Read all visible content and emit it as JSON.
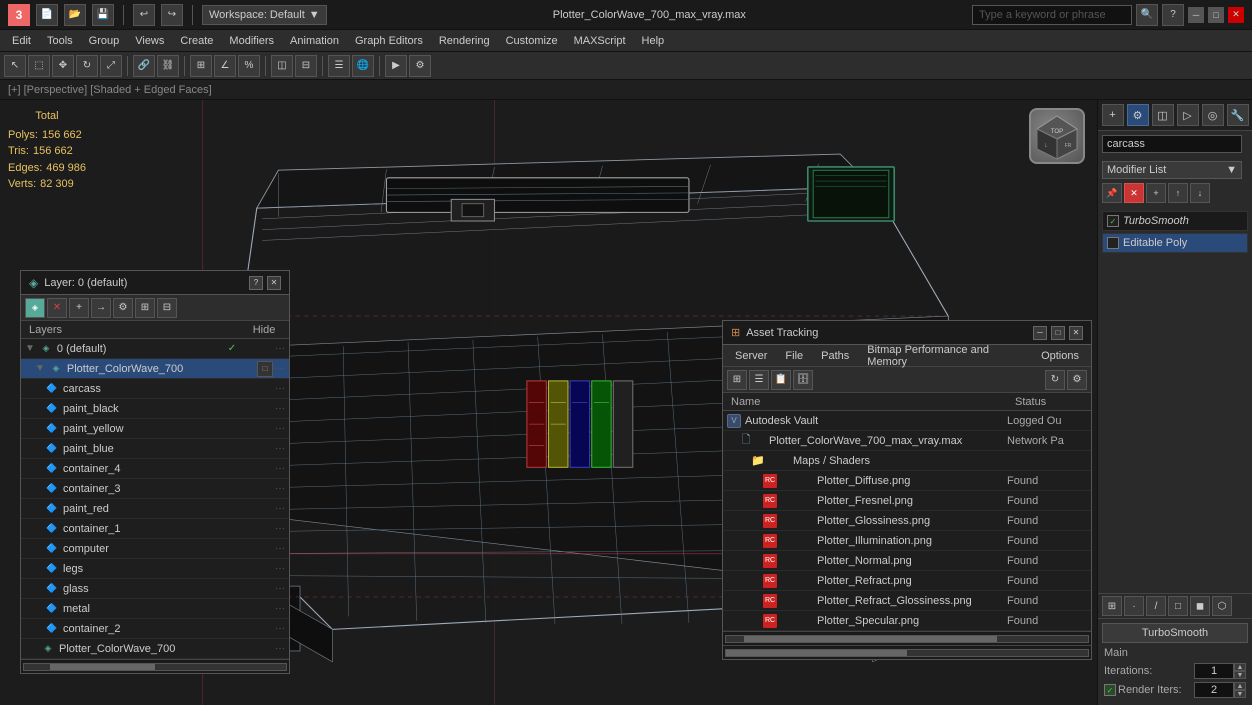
{
  "titlebar": {
    "filename": "Plotter_ColorWave_700_max_vray.max",
    "workspace_label": "Workspace: Default",
    "search_placeholder": "Type a keyword or phrase"
  },
  "menubar": {
    "items": [
      "Edit",
      "Tools",
      "Group",
      "Views",
      "Create",
      "Modifiers",
      "Animation",
      "Graph Editors",
      "Rendering",
      "Customize",
      "MAXScript",
      "Help"
    ]
  },
  "view_label": "[+] [Perspective] [Shaded + Edged Faces]",
  "stats": {
    "title": "Total",
    "polys_label": "Polys:",
    "polys_value": "156 662",
    "tris_label": "Tris:",
    "tris_value": "156 662",
    "edges_label": "Edges:",
    "edges_value": "469 986",
    "verts_label": "Verts:",
    "verts_value": "82 309"
  },
  "right_panel": {
    "name_field": "carcass",
    "modifier_list_label": "Modifier List",
    "modifiers": [
      {
        "name": "TurboSmooth",
        "checked": true,
        "italic": true
      },
      {
        "name": "Editable Poly",
        "checked": false,
        "italic": false
      }
    ],
    "turbosmooth": {
      "title": "TurboSmooth",
      "main_label": "Main",
      "iterations_label": "Iterations:",
      "iterations_value": "1",
      "render_iters_label": "Render Iters:",
      "render_iters_value": "2"
    }
  },
  "layer_panel": {
    "title": "Layer: 0 (default)",
    "question_mark": "?",
    "columns": {
      "name": "Layers",
      "hide": "Hide"
    },
    "items": [
      {
        "id": "layer-default",
        "name": "0 (default)",
        "indent": 0,
        "type": "layer",
        "checked": true,
        "active": false
      },
      {
        "id": "plotter-colorwave",
        "name": "Plotter_ColorWave_700",
        "indent": 1,
        "type": "object",
        "checked": false,
        "active": true
      },
      {
        "id": "carcass",
        "name": "carcass",
        "indent": 2,
        "type": "sub",
        "checked": false,
        "active": false
      },
      {
        "id": "paint-black",
        "name": "paint_black",
        "indent": 2,
        "type": "sub",
        "checked": false,
        "active": false
      },
      {
        "id": "paint-yellow",
        "name": "paint_yellow",
        "indent": 2,
        "type": "sub",
        "checked": false,
        "active": false
      },
      {
        "id": "paint-blue",
        "name": "paint_blue",
        "indent": 2,
        "type": "sub",
        "checked": false,
        "active": false
      },
      {
        "id": "container-4",
        "name": "container_4",
        "indent": 2,
        "type": "sub",
        "checked": false,
        "active": false
      },
      {
        "id": "container-3",
        "name": "container_3",
        "indent": 2,
        "type": "sub",
        "checked": false,
        "active": false
      },
      {
        "id": "paint-red",
        "name": "paint_red",
        "indent": 2,
        "type": "sub",
        "checked": false,
        "active": false
      },
      {
        "id": "container-1",
        "name": "container_1",
        "indent": 2,
        "type": "sub",
        "checked": false,
        "active": false
      },
      {
        "id": "computer",
        "name": "computer",
        "indent": 2,
        "type": "sub",
        "checked": false,
        "active": false
      },
      {
        "id": "legs",
        "name": "legs",
        "indent": 2,
        "type": "sub",
        "checked": false,
        "active": false
      },
      {
        "id": "glass",
        "name": "glass",
        "indent": 2,
        "type": "sub",
        "checked": false,
        "active": false
      },
      {
        "id": "metal",
        "name": "metal",
        "indent": 2,
        "type": "sub",
        "checked": false,
        "active": false
      },
      {
        "id": "container-2",
        "name": "container_2",
        "indent": 2,
        "type": "sub",
        "checked": false,
        "active": false
      },
      {
        "id": "plotter-cw-bottom",
        "name": "Plotter_ColorWave_700",
        "indent": 2,
        "type": "sub",
        "checked": false,
        "active": false
      }
    ]
  },
  "asset_panel": {
    "title": "Asset Tracking",
    "menu": [
      "Server",
      "File",
      "Paths",
      "Bitmap Performance and Memory",
      "Options"
    ],
    "columns": {
      "name": "Name",
      "status": "Status"
    },
    "rows": [
      {
        "id": "vault",
        "name": "Autodesk Vault",
        "indent": 0,
        "type": "vault",
        "status": "Logged Ou"
      },
      {
        "id": "file",
        "name": "Plotter_ColorWave_700_max_vray.max",
        "indent": 1,
        "type": "file",
        "status": "Network Pa"
      },
      {
        "id": "maps",
        "name": "Maps / Shaders",
        "indent": 2,
        "type": "folder",
        "status": ""
      },
      {
        "id": "diffuse",
        "name": "Plotter_Diffuse.png",
        "indent": 3,
        "type": "texture",
        "status": "Found"
      },
      {
        "id": "fresnel",
        "name": "Plotter_Fresnel.png",
        "indent": 3,
        "type": "texture",
        "status": "Found"
      },
      {
        "id": "glossiness",
        "name": "Plotter_Glossiness.png",
        "indent": 3,
        "type": "texture",
        "status": "Found"
      },
      {
        "id": "illumination",
        "name": "Plotter_Illumination.png",
        "indent": 3,
        "type": "texture",
        "status": "Found"
      },
      {
        "id": "normal",
        "name": "Plotter_Normal.png",
        "indent": 3,
        "type": "texture",
        "status": "Found"
      },
      {
        "id": "refract",
        "name": "Plotter_Refract.png",
        "indent": 3,
        "type": "texture",
        "status": "Found"
      },
      {
        "id": "refract-gloss",
        "name": "Plotter_Refract_Glossiness.png",
        "indent": 3,
        "type": "texture",
        "status": "Found"
      },
      {
        "id": "specular",
        "name": "Plotter_Specular.png",
        "indent": 3,
        "type": "texture",
        "status": "Found"
      }
    ]
  }
}
